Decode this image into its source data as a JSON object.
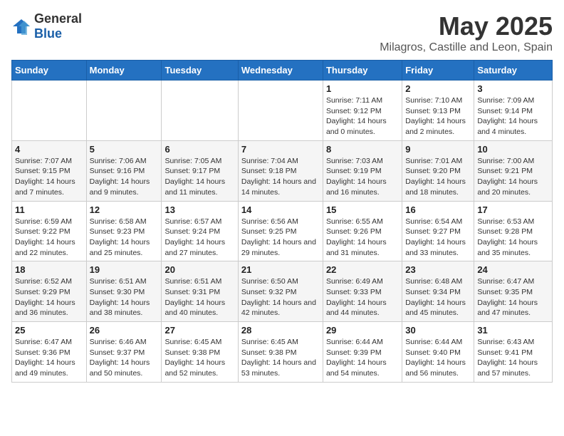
{
  "logo": {
    "general": "General",
    "blue": "Blue"
  },
  "title": "May 2025",
  "subtitle": "Milagros, Castille and Leon, Spain",
  "days_of_week": [
    "Sunday",
    "Monday",
    "Tuesday",
    "Wednesday",
    "Thursday",
    "Friday",
    "Saturday"
  ],
  "weeks": [
    [
      {
        "day": "",
        "sunrise": "",
        "sunset": "",
        "daylight": ""
      },
      {
        "day": "",
        "sunrise": "",
        "sunset": "",
        "daylight": ""
      },
      {
        "day": "",
        "sunrise": "",
        "sunset": "",
        "daylight": ""
      },
      {
        "day": "",
        "sunrise": "",
        "sunset": "",
        "daylight": ""
      },
      {
        "day": "1",
        "sunrise": "Sunrise: 7:11 AM",
        "sunset": "Sunset: 9:12 PM",
        "daylight": "Daylight: 14 hours and 0 minutes."
      },
      {
        "day": "2",
        "sunrise": "Sunrise: 7:10 AM",
        "sunset": "Sunset: 9:13 PM",
        "daylight": "Daylight: 14 hours and 2 minutes."
      },
      {
        "day": "3",
        "sunrise": "Sunrise: 7:09 AM",
        "sunset": "Sunset: 9:14 PM",
        "daylight": "Daylight: 14 hours and 4 minutes."
      }
    ],
    [
      {
        "day": "4",
        "sunrise": "Sunrise: 7:07 AM",
        "sunset": "Sunset: 9:15 PM",
        "daylight": "Daylight: 14 hours and 7 minutes."
      },
      {
        "day": "5",
        "sunrise": "Sunrise: 7:06 AM",
        "sunset": "Sunset: 9:16 PM",
        "daylight": "Daylight: 14 hours and 9 minutes."
      },
      {
        "day": "6",
        "sunrise": "Sunrise: 7:05 AM",
        "sunset": "Sunset: 9:17 PM",
        "daylight": "Daylight: 14 hours and 11 minutes."
      },
      {
        "day": "7",
        "sunrise": "Sunrise: 7:04 AM",
        "sunset": "Sunset: 9:18 PM",
        "daylight": "Daylight: 14 hours and 14 minutes."
      },
      {
        "day": "8",
        "sunrise": "Sunrise: 7:03 AM",
        "sunset": "Sunset: 9:19 PM",
        "daylight": "Daylight: 14 hours and 16 minutes."
      },
      {
        "day": "9",
        "sunrise": "Sunrise: 7:01 AM",
        "sunset": "Sunset: 9:20 PM",
        "daylight": "Daylight: 14 hours and 18 minutes."
      },
      {
        "day": "10",
        "sunrise": "Sunrise: 7:00 AM",
        "sunset": "Sunset: 9:21 PM",
        "daylight": "Daylight: 14 hours and 20 minutes."
      }
    ],
    [
      {
        "day": "11",
        "sunrise": "Sunrise: 6:59 AM",
        "sunset": "Sunset: 9:22 PM",
        "daylight": "Daylight: 14 hours and 22 minutes."
      },
      {
        "day": "12",
        "sunrise": "Sunrise: 6:58 AM",
        "sunset": "Sunset: 9:23 PM",
        "daylight": "Daylight: 14 hours and 25 minutes."
      },
      {
        "day": "13",
        "sunrise": "Sunrise: 6:57 AM",
        "sunset": "Sunset: 9:24 PM",
        "daylight": "Daylight: 14 hours and 27 minutes."
      },
      {
        "day": "14",
        "sunrise": "Sunrise: 6:56 AM",
        "sunset": "Sunset: 9:25 PM",
        "daylight": "Daylight: 14 hours and 29 minutes."
      },
      {
        "day": "15",
        "sunrise": "Sunrise: 6:55 AM",
        "sunset": "Sunset: 9:26 PM",
        "daylight": "Daylight: 14 hours and 31 minutes."
      },
      {
        "day": "16",
        "sunrise": "Sunrise: 6:54 AM",
        "sunset": "Sunset: 9:27 PM",
        "daylight": "Daylight: 14 hours and 33 minutes."
      },
      {
        "day": "17",
        "sunrise": "Sunrise: 6:53 AM",
        "sunset": "Sunset: 9:28 PM",
        "daylight": "Daylight: 14 hours and 35 minutes."
      }
    ],
    [
      {
        "day": "18",
        "sunrise": "Sunrise: 6:52 AM",
        "sunset": "Sunset: 9:29 PM",
        "daylight": "Daylight: 14 hours and 36 minutes."
      },
      {
        "day": "19",
        "sunrise": "Sunrise: 6:51 AM",
        "sunset": "Sunset: 9:30 PM",
        "daylight": "Daylight: 14 hours and 38 minutes."
      },
      {
        "day": "20",
        "sunrise": "Sunrise: 6:51 AM",
        "sunset": "Sunset: 9:31 PM",
        "daylight": "Daylight: 14 hours and 40 minutes."
      },
      {
        "day": "21",
        "sunrise": "Sunrise: 6:50 AM",
        "sunset": "Sunset: 9:32 PM",
        "daylight": "Daylight: 14 hours and 42 minutes."
      },
      {
        "day": "22",
        "sunrise": "Sunrise: 6:49 AM",
        "sunset": "Sunset: 9:33 PM",
        "daylight": "Daylight: 14 hours and 44 minutes."
      },
      {
        "day": "23",
        "sunrise": "Sunrise: 6:48 AM",
        "sunset": "Sunset: 9:34 PM",
        "daylight": "Daylight: 14 hours and 45 minutes."
      },
      {
        "day": "24",
        "sunrise": "Sunrise: 6:47 AM",
        "sunset": "Sunset: 9:35 PM",
        "daylight": "Daylight: 14 hours and 47 minutes."
      }
    ],
    [
      {
        "day": "25",
        "sunrise": "Sunrise: 6:47 AM",
        "sunset": "Sunset: 9:36 PM",
        "daylight": "Daylight: 14 hours and 49 minutes."
      },
      {
        "day": "26",
        "sunrise": "Sunrise: 6:46 AM",
        "sunset": "Sunset: 9:37 PM",
        "daylight": "Daylight: 14 hours and 50 minutes."
      },
      {
        "day": "27",
        "sunrise": "Sunrise: 6:45 AM",
        "sunset": "Sunset: 9:38 PM",
        "daylight": "Daylight: 14 hours and 52 minutes."
      },
      {
        "day": "28",
        "sunrise": "Sunrise: 6:45 AM",
        "sunset": "Sunset: 9:38 PM",
        "daylight": "Daylight: 14 hours and 53 minutes."
      },
      {
        "day": "29",
        "sunrise": "Sunrise: 6:44 AM",
        "sunset": "Sunset: 9:39 PM",
        "daylight": "Daylight: 14 hours and 54 minutes."
      },
      {
        "day": "30",
        "sunrise": "Sunrise: 6:44 AM",
        "sunset": "Sunset: 9:40 PM",
        "daylight": "Daylight: 14 hours and 56 minutes."
      },
      {
        "day": "31",
        "sunrise": "Sunrise: 6:43 AM",
        "sunset": "Sunset: 9:41 PM",
        "daylight": "Daylight: 14 hours and 57 minutes."
      }
    ]
  ]
}
